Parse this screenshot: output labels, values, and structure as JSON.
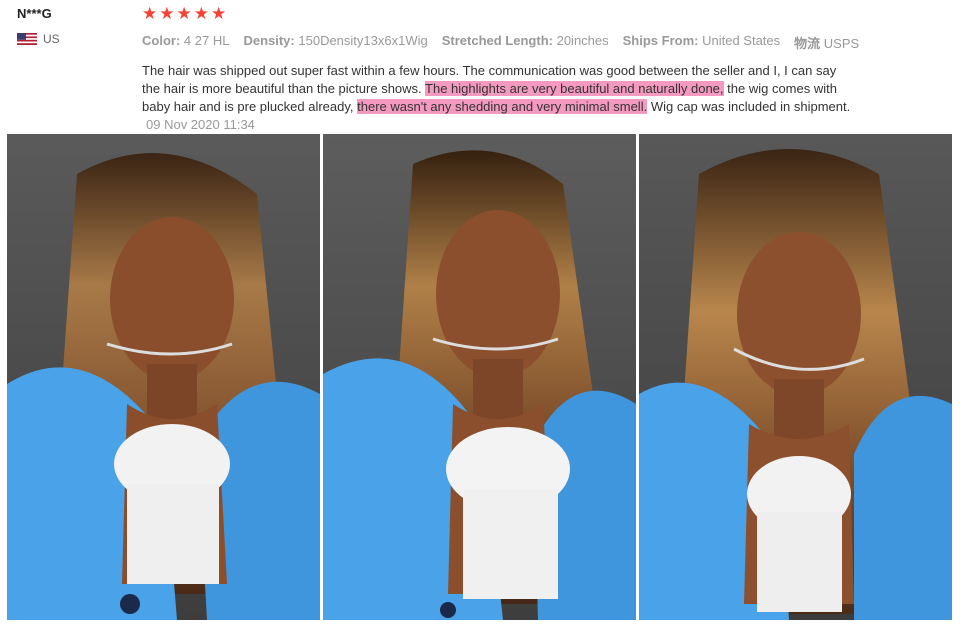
{
  "user": {
    "name": "N***G",
    "country": "US"
  },
  "rating": {
    "stars": 5,
    "star_glyph": "★",
    "color": "#f44336"
  },
  "attributes": [
    {
      "label": "Color:",
      "value": "4 27 HL"
    },
    {
      "label": "Density:",
      "value": "150Density13x6x1Wig"
    },
    {
      "label": "Stretched Length:",
      "value": "20inches"
    },
    {
      "label": "Ships From:",
      "value": "United States"
    },
    {
      "label": "物流",
      "value": "USPS"
    }
  ],
  "review": {
    "part1": "The hair was shipped out super fast within a few hours. The communication was good between the seller and I, I can say the hair is more beautiful than the picture shows.",
    "highlight1": "The highlights are very beautiful and naturally done,",
    "part2": "the wig comes with baby hair and is pre plucked already,",
    "highlight2": "there wasn't any shedding and very minimal smell.",
    "part3": "Wig cap was included in shipment.",
    "date": "09 Nov 2020 11:34",
    "highlight_color": "#f49ac1"
  },
  "photos": [
    {
      "name": "review-photo-1"
    },
    {
      "name": "review-photo-2"
    },
    {
      "name": "review-photo-3"
    }
  ]
}
